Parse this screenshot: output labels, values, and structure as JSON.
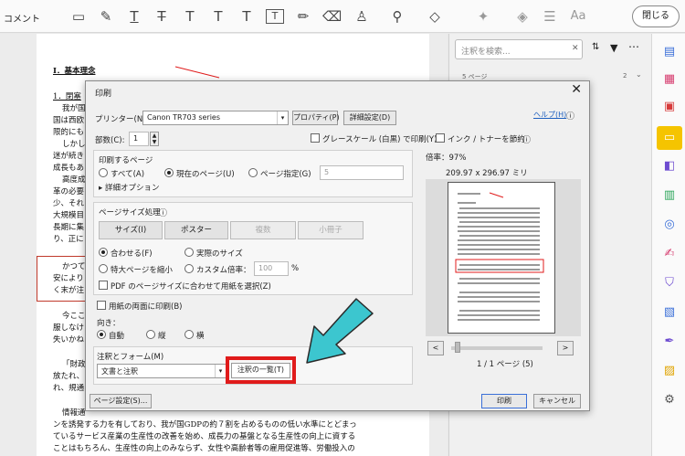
{
  "toolbar": {
    "label": "コメント",
    "close_label": "閉じる",
    "tools": [
      "sticky-note-icon",
      "highlight-pen-icon",
      "text-underline-icon",
      "text-strike-icon",
      "text-replace-icon",
      "text-insert-icon",
      "text-add-icon",
      "text-box-icon",
      "pencil-icon",
      "eraser-icon",
      "stamp-icon",
      "attach-icon",
      "shapes-icon",
      "pin-icon",
      "fill-icon",
      "lines-icon",
      "font-size-icon"
    ],
    "font_icon_text": "Aa"
  },
  "comments_panel": {
    "search_placeholder": "注釈を検索...",
    "page_header": "5 ページ",
    "page_count": "2"
  },
  "document": {
    "heading1": "Ⅰ．基本理念",
    "heading2": "1．閉塞",
    "lines_left": [
      "我が国",
      "国は西欧",
      "限的にも",
      "しかし",
      "迷が続き",
      "成長もあ",
      "高度成",
      "革の必要",
      "少、それ",
      "大規模目",
      "長期に集",
      "り、正に"
    ],
    "box_lines": [
      "かつて",
      "安により",
      "く末が注"
    ],
    "lines_left2": [
      "今ここ",
      "服しなけ",
      "失いかね"
    ],
    "lines_left3": [
      "「財政",
      "放たれ、",
      "れ、規通"
    ],
    "lines_left4": [
      "情報通"
    ],
    "bottom_lines": [
      "ンを誘発する力を有しており、我が国GDPの約７割を占めるものの低い水準にとどまっ",
      "ているサービス産業の生産性の改善を始め、成長力の基盤となる生産性の向上に資する",
      "ことはもちろん、生産性の向上のみならず、女性や高齢者等の雇用促進等、労働投入の"
    ]
  },
  "dialog": {
    "title": "印刷",
    "close": "✕",
    "printer_label": "プリンター(N):",
    "printer_value": "Canon TR703 series",
    "properties_btn": "プロパティ(P)",
    "advanced_btn": "詳細設定(D)",
    "help_link": "ヘルプ(H)",
    "copies_label": "部数(C):",
    "copies_value": "1",
    "grayscale_label": "グレースケール (白黒) で印刷(Y)",
    "save_ink_label": "インク / トナーを節約",
    "pages_group_title": "印刷するページ",
    "radio_all": "すべて(A)",
    "radio_current": "現在のページ(U)",
    "radio_range": "ページ指定(G)",
    "range_value": "5",
    "more_options": "▸ 詳細オプション",
    "size_group_title": "ページサイズ処理",
    "btn_size": "サイズ(I)",
    "btn_poster": "ポスター",
    "btn_multiple": "複数",
    "btn_booklet": "小冊子",
    "radio_fit": "合わせる(F)",
    "radio_actual": "実際のサイズ",
    "radio_shrink": "特大ページを縮小",
    "radio_custom": "カスタム倍率：",
    "custom_value": "100",
    "percent": "%",
    "pdf_paper_label": "PDF のページサイズに合わせて用紙を選択(Z)",
    "duplex_label": "用紙の両面に印刷(B)",
    "orientation_label": "向き：",
    "radio_auto": "自動",
    "radio_portrait": "縦",
    "radio_landscape": "横",
    "comments_forms_label": "注釈とフォーム(M)",
    "comments_forms_value": "文書と注釈",
    "summarize_btn": "注釈の一覧(T)",
    "page_setup_btn": "ページ設定(S)...",
    "print_btn": "印刷",
    "cancel_btn": "キャンセル",
    "scale_label": "倍率：97%",
    "paper_size": "209.97 x 296.97 ミリ",
    "page_indicator": "1 / 1 ページ (5)",
    "prev": "<",
    "next": ">"
  },
  "colors": {
    "highlight_red": "#e01b1b",
    "arrow_cyan": "#3cc6cf",
    "accent_yellow": "#f5c400"
  }
}
